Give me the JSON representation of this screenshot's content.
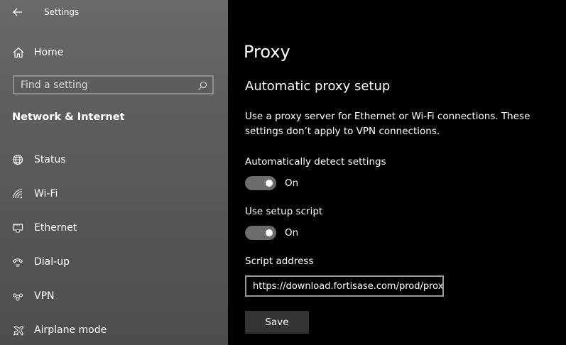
{
  "window": {
    "title": "Settings"
  },
  "sidebar": {
    "home_label": "Home",
    "search_placeholder": "Find a setting",
    "section_heading": "Network & Internet",
    "items": [
      {
        "label": "Status",
        "icon": "globe-icon"
      },
      {
        "label": "Wi-Fi",
        "icon": "wifi-icon"
      },
      {
        "label": "Ethernet",
        "icon": "ethernet-icon"
      },
      {
        "label": "Dial-up",
        "icon": "phone-icon"
      },
      {
        "label": "VPN",
        "icon": "vpn-icon"
      },
      {
        "label": "Airplane mode",
        "icon": "airplane-icon"
      }
    ]
  },
  "main": {
    "page_title": "Proxy",
    "section_title": "Automatic proxy setup",
    "description": "Use a proxy server for Ethernet or Wi-Fi connections. These settings don’t apply to VPN connections.",
    "auto_detect": {
      "label": "Automatically detect settings",
      "state": "On"
    },
    "setup_script": {
      "label": "Use setup script",
      "state": "On"
    },
    "script_address": {
      "label": "Script address",
      "value": "https://download.fortisase.com/prod/proxy.pac"
    },
    "save_label": "Save"
  },
  "colors": {
    "sidebar_bg": "#5e5e5e",
    "main_bg": "#000000",
    "toggle_bg": "#6b6b6b",
    "button_bg": "#333333"
  }
}
